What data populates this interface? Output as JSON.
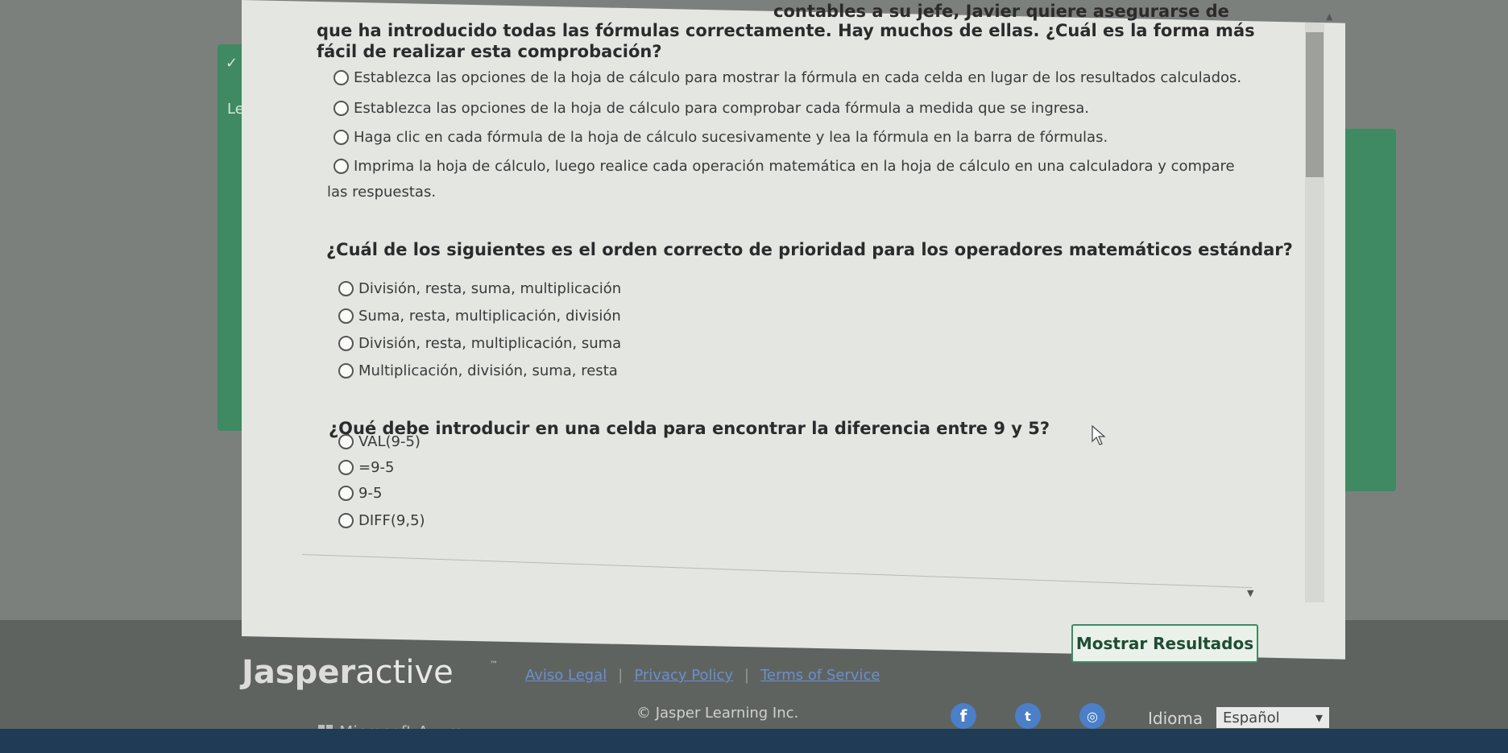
{
  "q0_tail": "contables a su jefe, Javier quiere asegurarse de",
  "q0_line2": "que ha introducido todas las fórmulas correctamente. Hay muchos de ellas. ¿Cuál es la forma más",
  "q0_line3": "fácil de realizar esta comprobación?",
  "q0_options": [
    "Establezca las opciones de la hoja de cálculo para mostrar la fórmula en cada celda en lugar de los resultados calculados.",
    "Establezca las opciones de la hoja de cálculo para comprobar cada fórmula a medida que se ingresa.",
    "Haga clic en cada fórmula de la hoja de cálculo sucesivamente y lea la fórmula en la barra de fórmulas.",
    "Imprima la hoja de cálculo, luego realice cada operación matemática en la hoja de cálculo en una calculadora y compare"
  ],
  "q0_option4_cont": "las respuestas.",
  "q1": "¿Cuál de los siguientes es el orden correcto de prioridad para los operadores matemáticos estándar?",
  "q1_options": [
    "División, resta, suma, multiplicación",
    "Suma, resta, multiplicación, división",
    "División, resta, multiplicación, suma",
    "Multiplicación, división, suma, resta"
  ],
  "q2": "¿Qué debe introducir en una celda para encontrar la diferencia entre 9 y 5?",
  "q2_options": [
    "VAL(9-5)",
    "=9-5",
    "9-5",
    "DIFF(9,5)"
  ],
  "side_labels": [
    "✓ L",
    "Le"
  ],
  "show_results_button": "Mostrar Resultados",
  "footer": {
    "brand_bold": "Jasper",
    "brand_light": "active",
    "trademark": "™",
    "links": [
      "Aviso Legal",
      "Privacy Policy",
      "Terms of Service"
    ],
    "copyright": "© Jasper Learning Inc.",
    "azure": "Microsoft Azure",
    "language_label": "Idioma",
    "language_value": "Español"
  },
  "colors": {
    "accent": "#3f8a62",
    "panel": "#e4e6e2",
    "link": "#6a8fd0"
  }
}
